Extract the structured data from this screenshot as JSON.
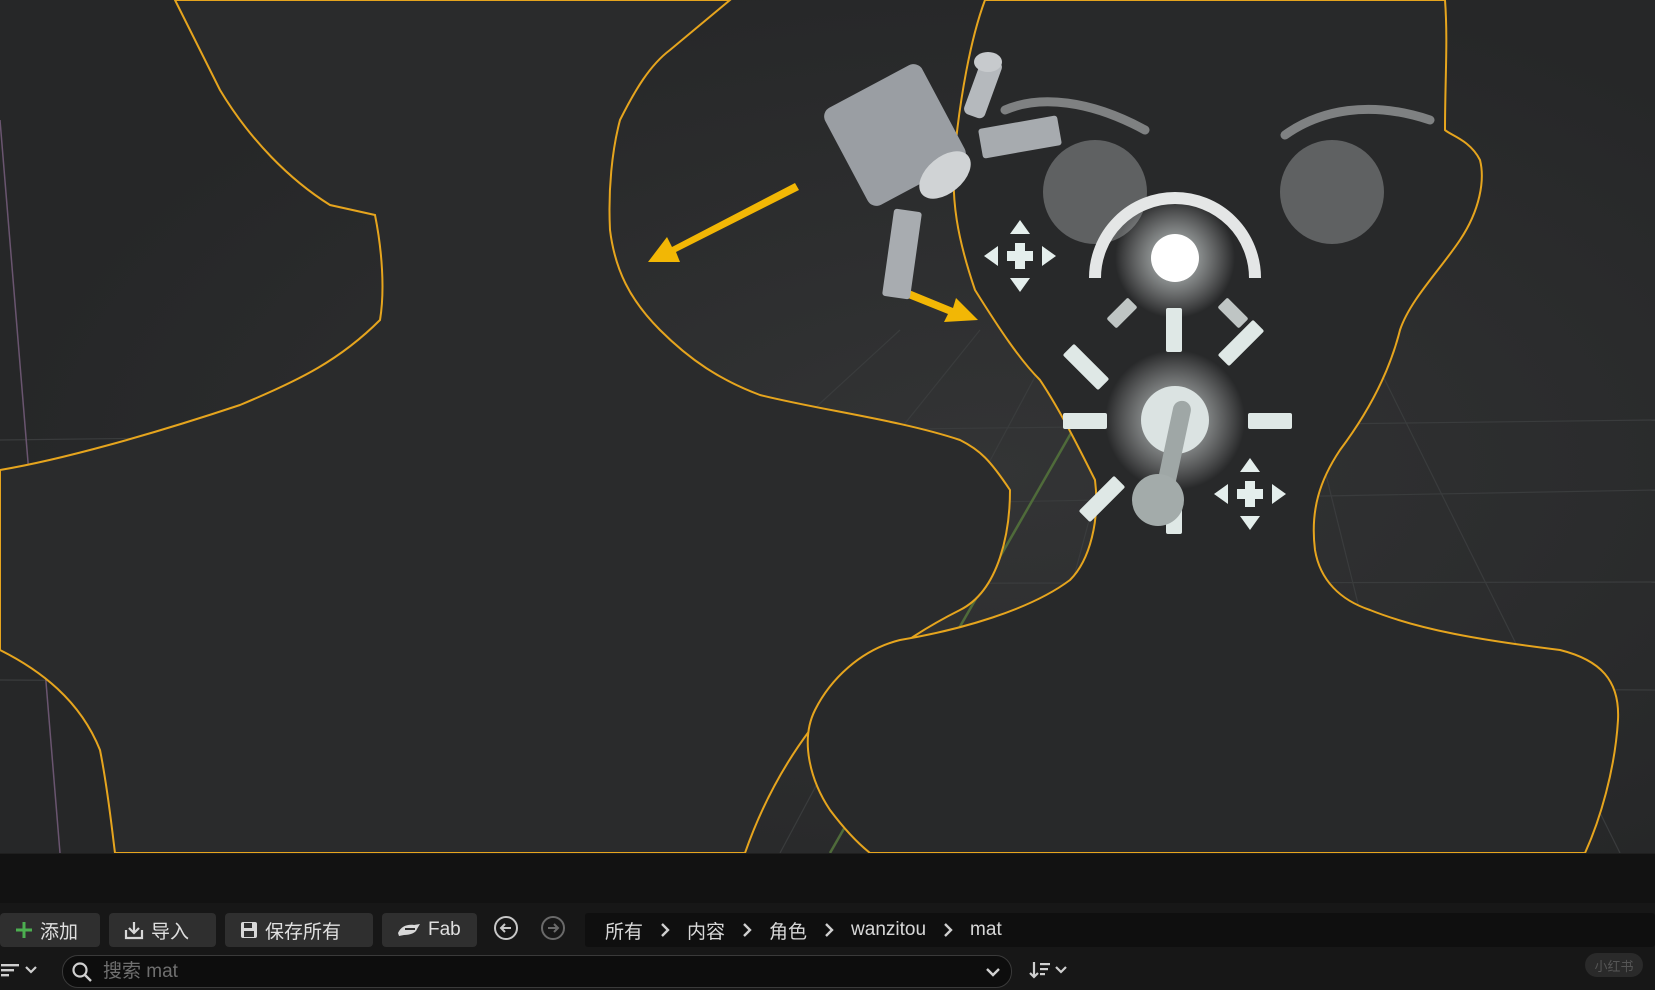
{
  "toolbar": {
    "add_label": "添加",
    "import_label": "导入",
    "save_all_label": "保存所有",
    "fab_label": "Fab"
  },
  "breadcrumb": [
    "所有",
    "内容",
    "角色",
    "wanzitou",
    "mat"
  ],
  "search": {
    "placeholder": "搜索 mat"
  },
  "watermark": "小红书",
  "colors": {
    "viewport_bg": "#2a2b2c",
    "selection_outline": "#e6a51e",
    "arrow_annotation": "#f2b705",
    "toolbar_bg": "#171717",
    "button_bg": "#2f2f2f",
    "add_icon": "#4caf50"
  },
  "icons": [
    "plus-icon",
    "import-icon",
    "save-icon",
    "fab-icon",
    "back-icon",
    "forward-icon",
    "chevron-right-icon",
    "filter-icon",
    "search-icon",
    "chevron-down-icon",
    "sort-icon"
  ]
}
